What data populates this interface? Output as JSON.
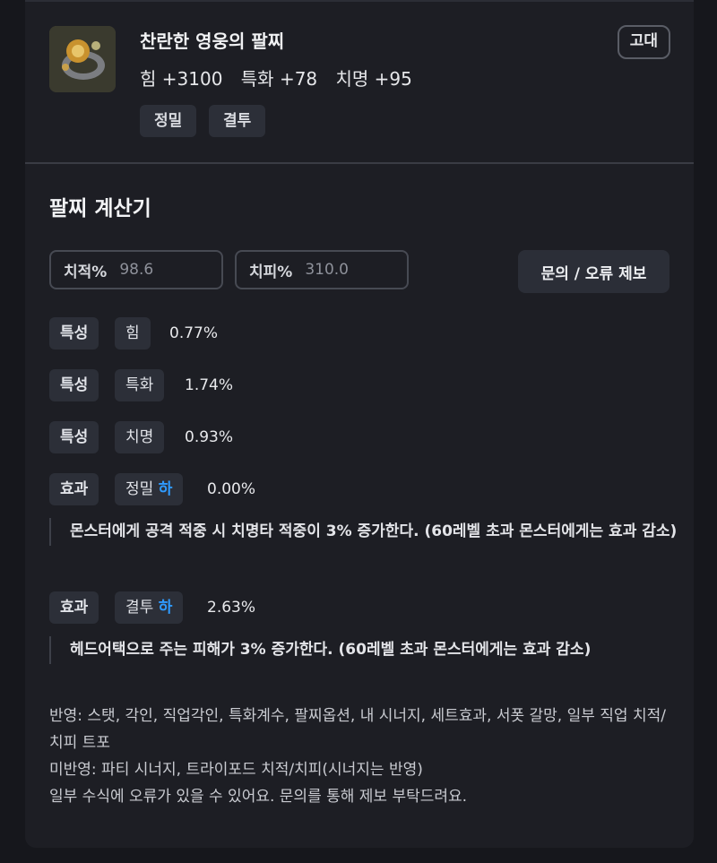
{
  "item": {
    "name": "찬란한 영웅의 팔찌",
    "icon": "bracelet-item-icon",
    "stats": [
      "힘 +3100",
      "특화 +78",
      "치명 +95"
    ],
    "grade": "고대",
    "tags": [
      "정밀",
      "결투"
    ]
  },
  "calculator": {
    "title": "팔찌 계산기",
    "crit_rate": {
      "label": "치적%",
      "placeholder": "98.6"
    },
    "crit_damage": {
      "label": "치피%",
      "placeholder": "310.0"
    },
    "report_button": "문의 / 오류 제보",
    "rows": [
      {
        "type": "특성",
        "name": "힘",
        "grade": "",
        "value": "0.77%"
      },
      {
        "type": "특성",
        "name": "특화",
        "grade": "",
        "value": "1.74%"
      },
      {
        "type": "특성",
        "name": "치명",
        "grade": "",
        "value": "0.93%"
      },
      {
        "type": "효과",
        "name": "정밀",
        "grade": "하",
        "value": "0.00%",
        "description": "몬스터에게 공격 적중 시 치명타 적중이 3% 증가한다. (60레벨 초과 몬스터에게는 효과 감소)"
      },
      {
        "type": "효과",
        "name": "결투",
        "grade": "하",
        "value": "2.63%",
        "description": "헤드어택으로 주는 피해가 3% 증가한다. (60레벨 초과 몬스터에게는 효과 감소)"
      }
    ],
    "notes": [
      "반영: 스탯, 각인, 직업각인, 특화계수, 팔찌옵션, 내 시너지, 세트효과, 서폿 갈망, 일부 직업 치적/치피 트포",
      "미반영: 파티 시너지, 트라이포드 치적/치피(시너지는 반영)",
      "일부 수식에 오류가 있을 수 있어요. 문의를 통해 제보 부탁드려요."
    ]
  },
  "colors": {
    "accent_blue": "#2f9bff",
    "background": "#1d1e24",
    "chip": "#2c2f38"
  }
}
